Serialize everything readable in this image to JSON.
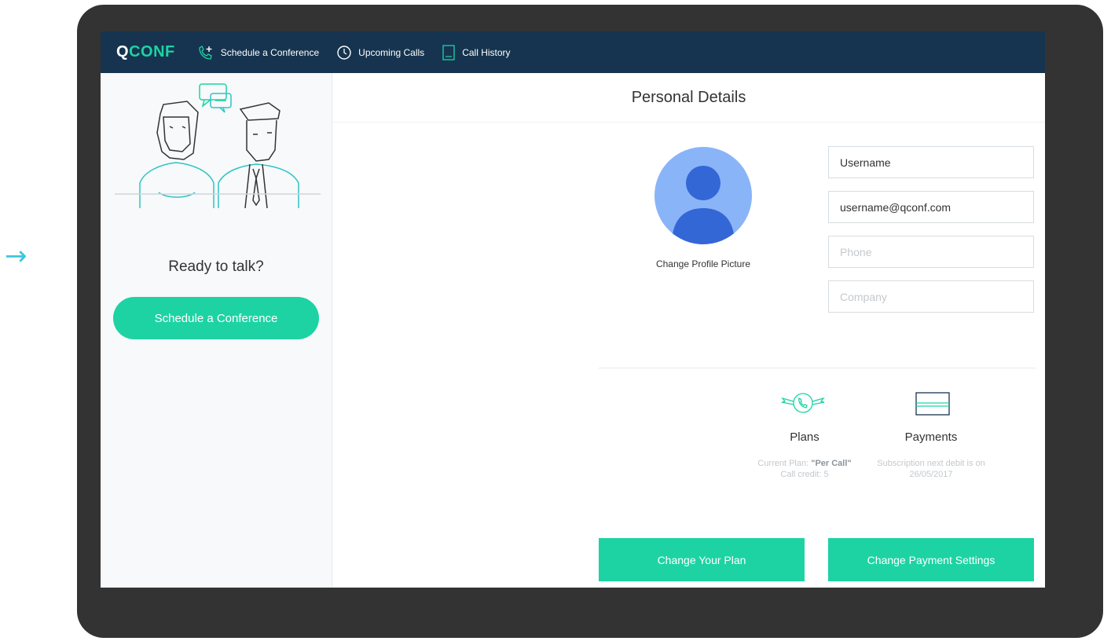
{
  "app": {
    "logo_q": "Q",
    "logo_rest": "CONF"
  },
  "nav": {
    "items": [
      {
        "label": "Schedule a Conference",
        "icon": "phone-add-icon"
      },
      {
        "label": "Upcoming Calls",
        "icon": "clock-icon"
      },
      {
        "label": "Call History",
        "icon": "document-icon"
      }
    ]
  },
  "sidebar": {
    "illustration": "two-people-talking-illustration",
    "title": "Ready to talk?",
    "cta_label": "Schedule a Conference"
  },
  "main": {
    "title": "Personal Details",
    "avatar_caption": "Change Profile Picture",
    "form": {
      "username": {
        "value": "Username",
        "placeholder": ""
      },
      "email": {
        "value": "username@qconf.com",
        "placeholder": ""
      },
      "phone": {
        "value": "",
        "placeholder": "Phone"
      },
      "company": {
        "value": "",
        "placeholder": "Company"
      }
    },
    "plans": {
      "title": "Plans",
      "icon": "winged-phone-icon",
      "desc_prefix": "Current Plan: ",
      "current_plan": "\"Per Call\"",
      "credit_line": "Call credit: 5",
      "button_label": "Change Your Plan"
    },
    "payments": {
      "title": "Payments",
      "icon": "credit-card-icon",
      "desc_line1": "Subscription next debit is on",
      "desc_line2": "26/05/2017",
      "button_label": "Change Payment Settings"
    }
  },
  "colors": {
    "nav_bg": "#16344f",
    "accent": "#1dd3a3",
    "illustration_teal": "#2ec4c4",
    "avatar_bg": "#8ab4f8",
    "avatar_figure": "#3367d6",
    "device_frame": "#333333",
    "arrow": "#3fc6dd"
  }
}
